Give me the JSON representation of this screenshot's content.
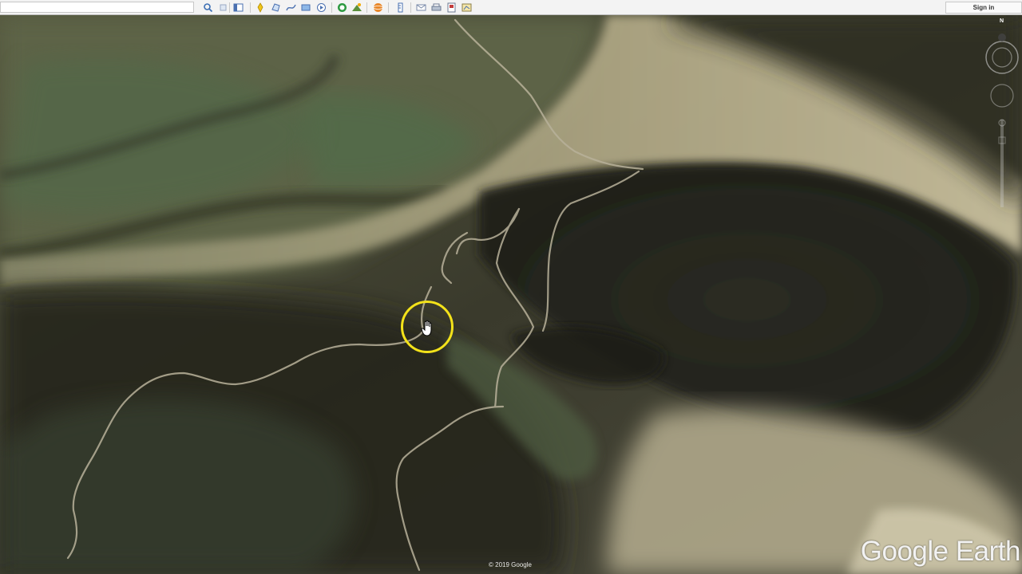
{
  "app": {
    "signin_label": "Sign in"
  },
  "toolbar": {
    "search_value": "",
    "tools": [
      {
        "icon": "search-icon"
      },
      {
        "icon": "layers-icon"
      },
      {
        "icon": "sidebar-icon"
      },
      {
        "icon": "placemark-icon"
      },
      {
        "icon": "polygon-icon"
      },
      {
        "icon": "path-icon"
      },
      {
        "icon": "overlay-icon"
      },
      {
        "icon": "tour-icon"
      },
      {
        "icon": "historical-imagery-icon"
      },
      {
        "icon": "sunlight-icon"
      },
      {
        "icon": "planets-icon"
      },
      {
        "icon": "ruler-icon"
      },
      {
        "icon": "email-icon"
      },
      {
        "icon": "print-icon"
      },
      {
        "icon": "save-image-icon"
      },
      {
        "icon": "view-in-maps-icon"
      }
    ]
  },
  "map": {
    "copyright": "© 2019 Google",
    "brand": "Google Earth",
    "compass_label": "N"
  },
  "colors": {
    "cursor_ring": "#f3e21a",
    "toolbar_bg": "#f3f3f3"
  }
}
